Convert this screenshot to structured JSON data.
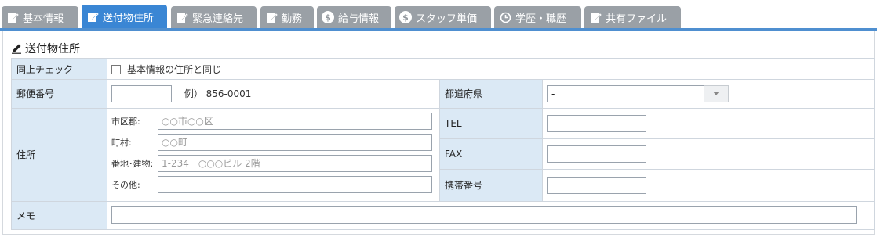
{
  "tabs": [
    {
      "label": "基本情報",
      "icon": "edit-icon",
      "active": false
    },
    {
      "label": "送付物住所",
      "icon": "edit-icon",
      "active": true
    },
    {
      "label": "緊急連絡先",
      "icon": "edit-icon",
      "active": false
    },
    {
      "label": "勤務",
      "icon": "edit-icon",
      "active": false
    },
    {
      "label": "給与情報",
      "icon": "dollar-icon",
      "active": false
    },
    {
      "label": "スタッフ単価",
      "icon": "dollar-icon",
      "active": false
    },
    {
      "label": "学歴・職歴",
      "icon": "clock-icon",
      "active": false
    },
    {
      "label": "共有ファイル",
      "icon": "edit-icon",
      "active": false
    }
  ],
  "section": {
    "title": "送付物住所",
    "icon": "pencil-icon"
  },
  "form": {
    "same_check": {
      "label": "同上チェック",
      "checkbox_text": "基本情報の住所と同じ",
      "checked": false
    },
    "postal": {
      "label": "郵便番号",
      "value": "",
      "example": "例） 856-0001"
    },
    "prefecture": {
      "label": "都道府県",
      "selected": "-"
    },
    "address": {
      "label": "住所",
      "city": {
        "label": "市区郡:",
        "placeholder": "○○市○○区",
        "value": ""
      },
      "town": {
        "label": "町村:",
        "placeholder": "○○町",
        "value": ""
      },
      "block": {
        "label": "番地･建物:",
        "placeholder": "1-234　○○○ビル 2階",
        "value": ""
      },
      "other": {
        "label": "その他:",
        "placeholder": "",
        "value": ""
      }
    },
    "tel": {
      "label": "TEL",
      "value": ""
    },
    "fax": {
      "label": "FAX",
      "value": ""
    },
    "mobile": {
      "label": "携帯番号",
      "value": ""
    },
    "memo": {
      "label": "メモ",
      "value": ""
    }
  },
  "colors": {
    "active_tab": "#3a86d4",
    "inactive_tab": "#9aa0a6",
    "label_bg": "#dbe9f5",
    "border": "#cfd6de"
  }
}
